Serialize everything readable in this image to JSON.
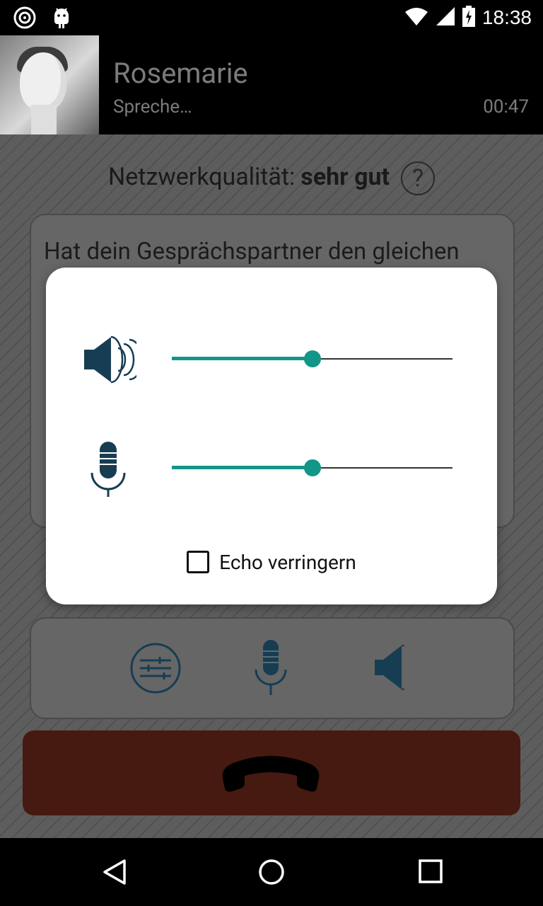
{
  "status_bar": {
    "time": "18:38",
    "icons": [
      "sync-icon",
      "android-icon",
      "wifi-icon",
      "signal-icon",
      "battery-charging-icon"
    ]
  },
  "call": {
    "caller_name": "Rosemarie",
    "status": "Spreche…",
    "duration": "00:47"
  },
  "network": {
    "label": "Netzwerkqualität:",
    "value": "sehr gut"
  },
  "quality_question": "Hat dein Gesprächspartner den gleichen",
  "volume_dialog": {
    "speaker_level_percent": 50,
    "mic_level_percent": 50,
    "echo_checkbox_label": "Echo verringern",
    "echo_checked": false
  },
  "controls": {
    "icons": [
      "equalizer-icon",
      "microphone-icon",
      "speaker-icon"
    ]
  },
  "colors": {
    "accent": "#129688",
    "end_call": "#461a10",
    "icon_dark": "#173d52"
  }
}
